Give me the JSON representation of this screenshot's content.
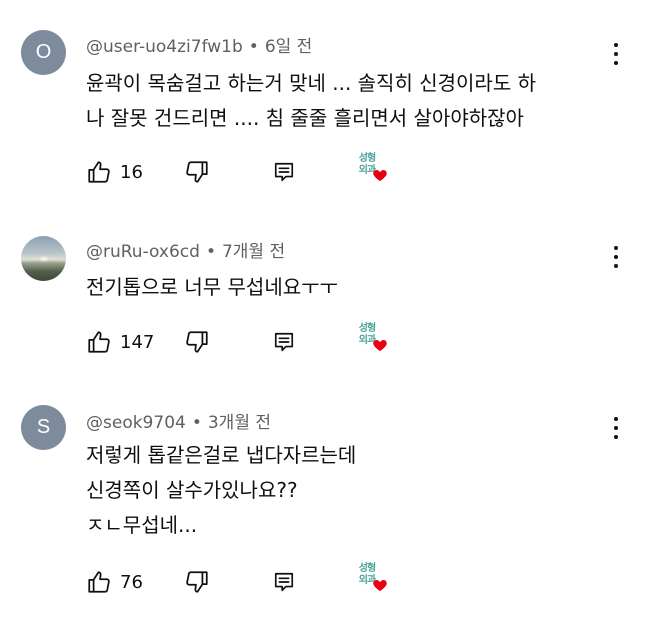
{
  "comments": [
    {
      "avatar_letter": "O",
      "avatar_color": "#7d8b9c",
      "handle": "@user-uo4zi7fw1b",
      "time": "6일 전",
      "lines": [
        "윤곽이 목숨걸고 하는거 맞네 ... 솔직히 신경이라도 하",
        "나 잘못 건드리면 .... 침 줄줄 흘리면서 살아야하잖아"
      ],
      "likes": "16",
      "creator_badge": "성형외과"
    },
    {
      "avatar_letter": "",
      "handle": "@ruRu-ox6cd",
      "time": "7개월 전",
      "lines": [
        "전기톱으로 너무 무섭네요ㅜㅜ"
      ],
      "likes": "147",
      "creator_badge": "성형외과"
    },
    {
      "avatar_letter": "S",
      "avatar_color": "#7d8b9c",
      "handle": "@seok9704",
      "time": "3개월 전",
      "lines": [
        "저렇게 톱같은걸로 냅다자르는데",
        "신경쪽이 살수가있나요??",
        "ㅈㄴ무섭네..."
      ],
      "likes": "76",
      "creator_badge": "성형외과"
    }
  ],
  "icons": {
    "like": "thumbs-up-icon",
    "dislike": "thumbs-down-icon",
    "reply": "reply-icon",
    "menu": "more-vert-icon",
    "heart": "heart-icon"
  },
  "colors": {
    "heart": "#e60012",
    "meta_text": "#606060",
    "badge_text": "#4aa59a"
  }
}
